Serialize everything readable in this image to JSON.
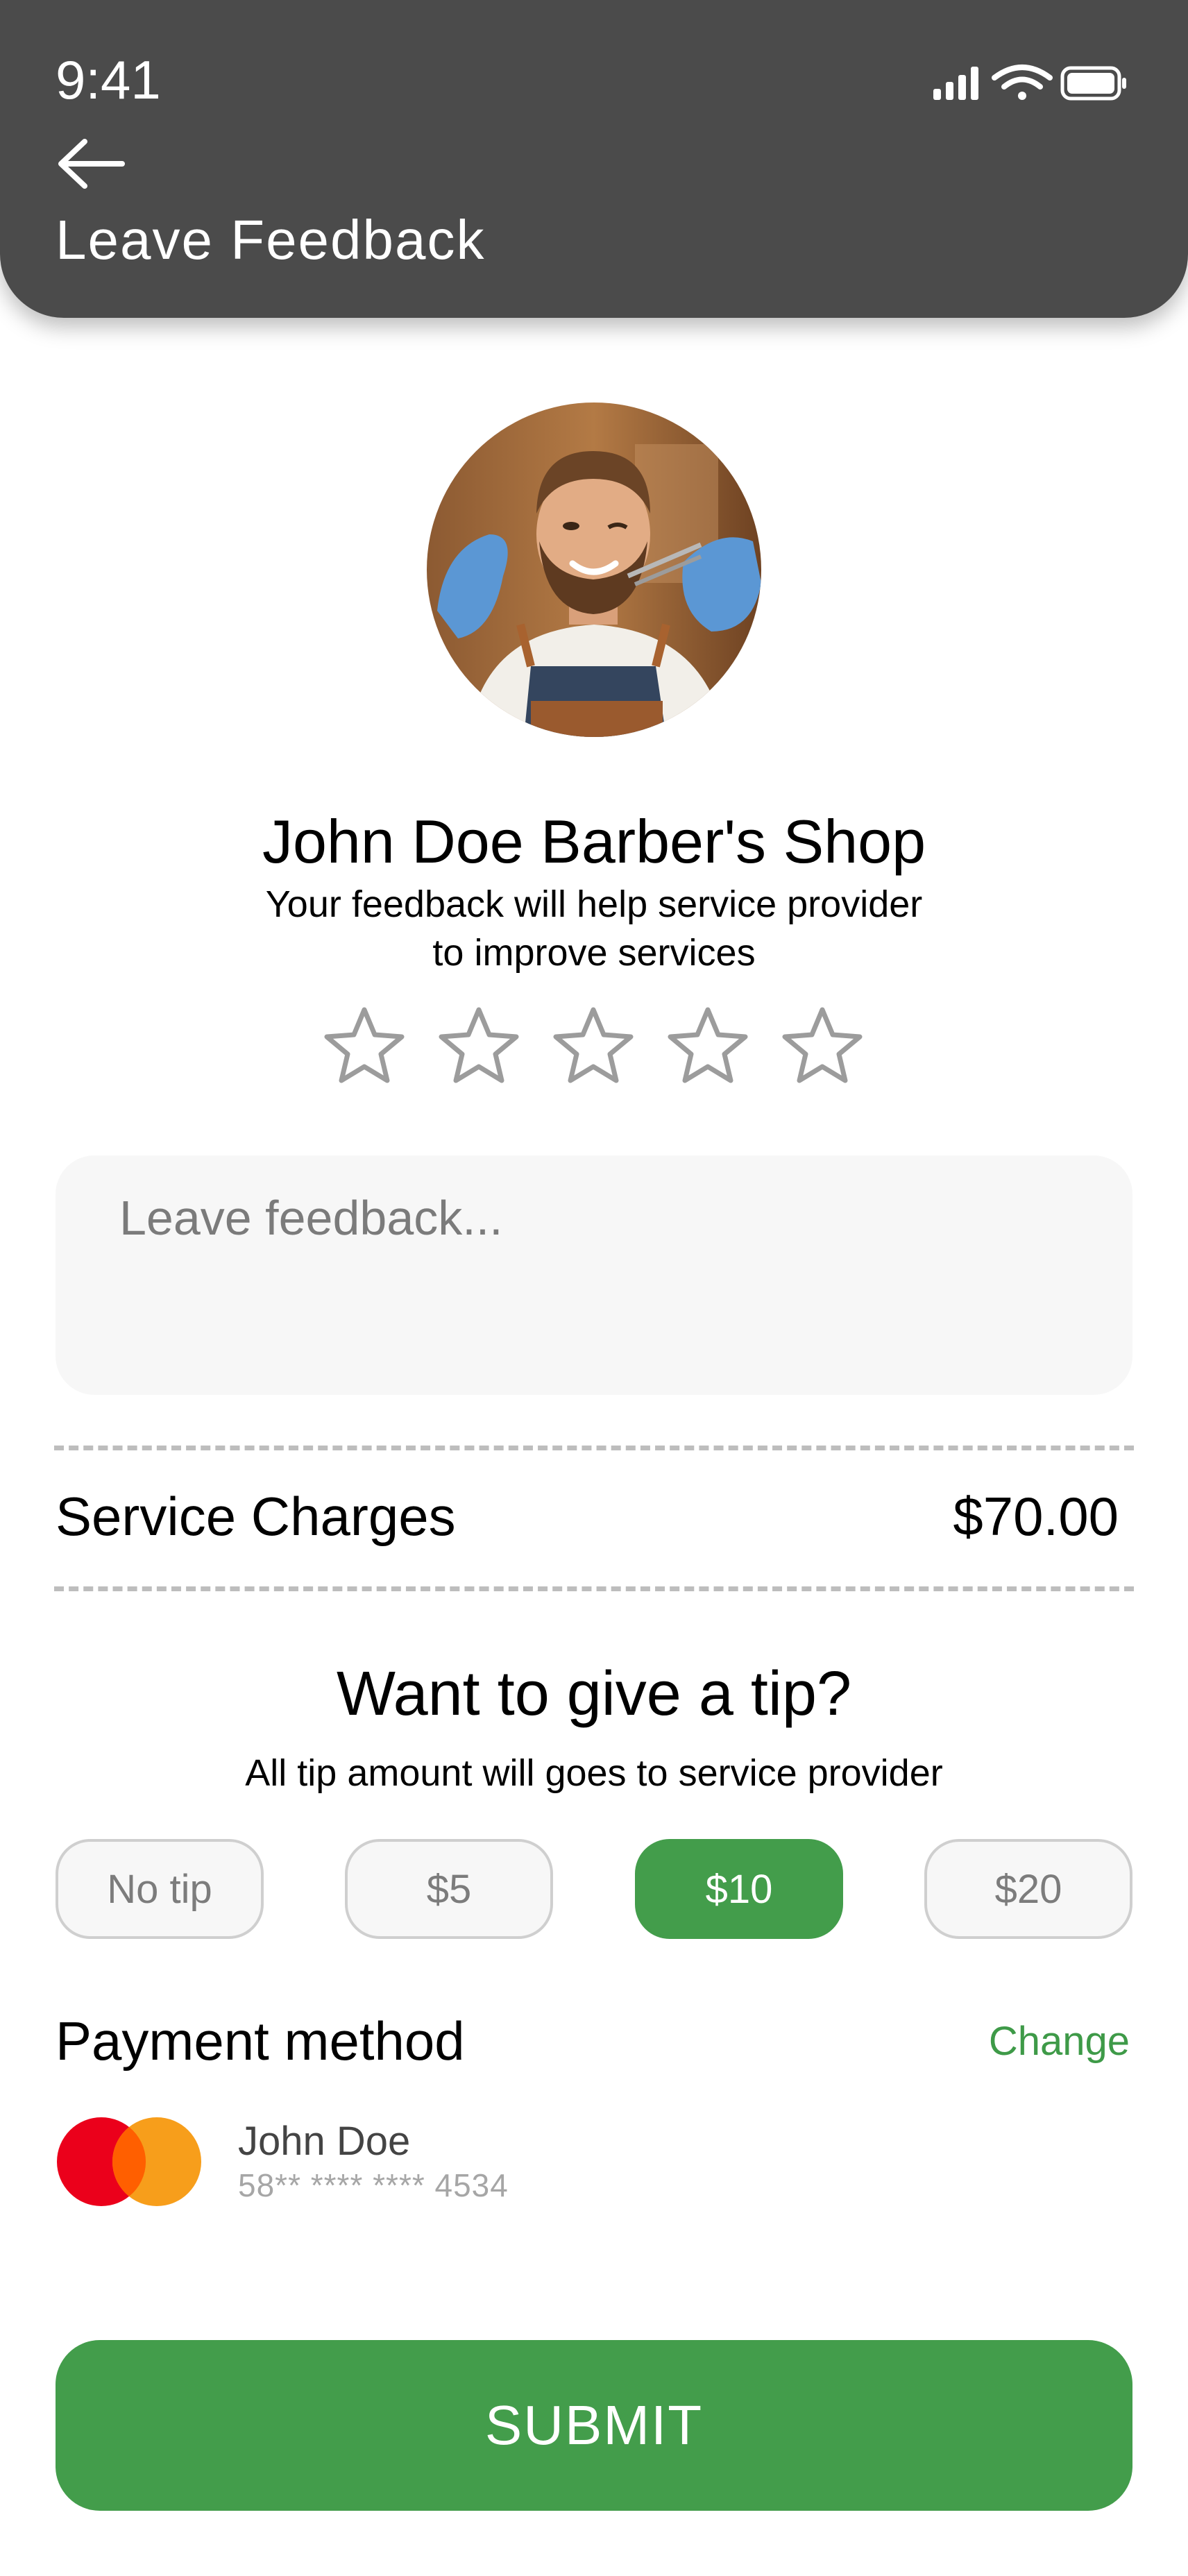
{
  "status_bar": {
    "time": "9:41"
  },
  "header": {
    "title": "Leave Feedback"
  },
  "provider": {
    "name": "John Doe Barber's Shop",
    "subtitle_line1": "Your feedback will help service provider",
    "subtitle_line2": "to improve services"
  },
  "rating": {
    "max": 5,
    "value": 0
  },
  "feedback": {
    "placeholder": "Leave feedback...",
    "value": ""
  },
  "charges": {
    "label": "Service Charges",
    "amount": "$70.00"
  },
  "tip": {
    "title": "Want to give a tip?",
    "subtitle": "All tip amount will goes to service provider",
    "options": [
      "No tip",
      "$5",
      "$10",
      "$20"
    ],
    "selected": "$10"
  },
  "payment": {
    "title": "Payment method",
    "change_label": "Change",
    "card_holder": "John Doe",
    "card_number": "58** **** **** 4534"
  },
  "submit": {
    "label": "SUBMIT"
  },
  "colors": {
    "header_bg": "#4b4b4b",
    "accent_green": "#439d4b",
    "mastercard_red": "#eb001b",
    "mastercard_orange": "#f79e1b"
  }
}
